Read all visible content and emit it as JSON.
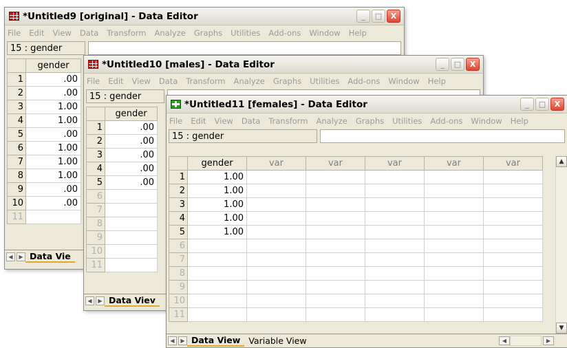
{
  "menu": [
    "File",
    "Edit",
    "View",
    "Data",
    "Transform",
    "Analyze",
    "Graphs",
    "Utilities",
    "Add-ons",
    "Window",
    "Help"
  ],
  "window_buttons": {
    "minimize": "_",
    "maximize": "□",
    "close": "X"
  },
  "windows": {
    "w1": {
      "title": "*Untitled9 [original] - Data Editor",
      "var_ref": "15 : gender",
      "col": "gender",
      "rows": [
        "1",
        "2",
        "3",
        "4",
        "5",
        "6",
        "7",
        "8",
        "9",
        "10",
        "11"
      ],
      "values": [
        ".00",
        ".00",
        "1.00",
        "1.00",
        ".00",
        "1.00",
        "1.00",
        "1.00",
        ".00",
        ".00",
        ""
      ],
      "tab": "Data Vie"
    },
    "w2": {
      "title": "*Untitled10 [males] - Data Editor",
      "var_ref": "15 : gender",
      "col": "gender",
      "rows": [
        "1",
        "2",
        "3",
        "4",
        "5",
        "6",
        "7",
        "8",
        "9",
        "10",
        "11"
      ],
      "values": [
        ".00",
        ".00",
        ".00",
        ".00",
        ".00",
        "",
        "",
        "",
        "",
        "",
        ""
      ],
      "tab": "Data Viev"
    },
    "w3": {
      "title": "*Untitled11 [females] - Data Editor",
      "var_ref": "15 : gender",
      "cols": [
        "gender",
        "var",
        "var",
        "var",
        "var",
        "var"
      ],
      "rows": [
        "1",
        "2",
        "3",
        "4",
        "5",
        "6",
        "7",
        "8",
        "9",
        "10",
        "11"
      ],
      "values": [
        "1.00",
        "1.00",
        "1.00",
        "1.00",
        "1.00",
        "",
        "",
        "",
        "",
        "",
        ""
      ],
      "tabs": [
        "Data View",
        "Variable View"
      ]
    }
  }
}
